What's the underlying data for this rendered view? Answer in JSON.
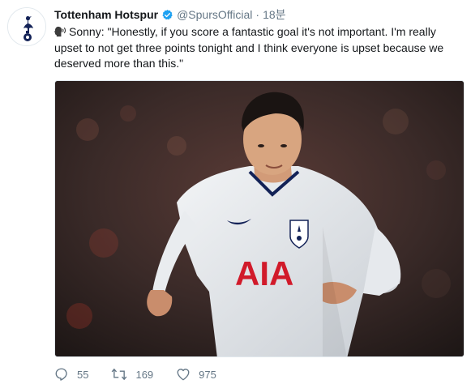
{
  "tweet": {
    "display_name": "Tottenham Hotspur",
    "handle": "@SpursOfficial",
    "separator": "·",
    "time": "18분",
    "text_line_1": "Sonny: \"Honestly, if you score a fantastic goal it's not important. I'm really",
    "text_line_2": "upset to not get three points tonight and I think everyone is upset because we",
    "text_line_3": "deserved more than this.\"",
    "speaker_icon": "speaking-head-icon",
    "verified_icon": "verified-badge-icon",
    "brand_color": "#1da1f2",
    "media_description_icon": "photo-of-player",
    "shirt_text": "AIA"
  },
  "actions": {
    "replies": "55",
    "retweets": "169",
    "likes": "975",
    "reply_icon": "reply-icon",
    "retweet_icon": "retweet-icon",
    "like_icon": "heart-icon"
  }
}
